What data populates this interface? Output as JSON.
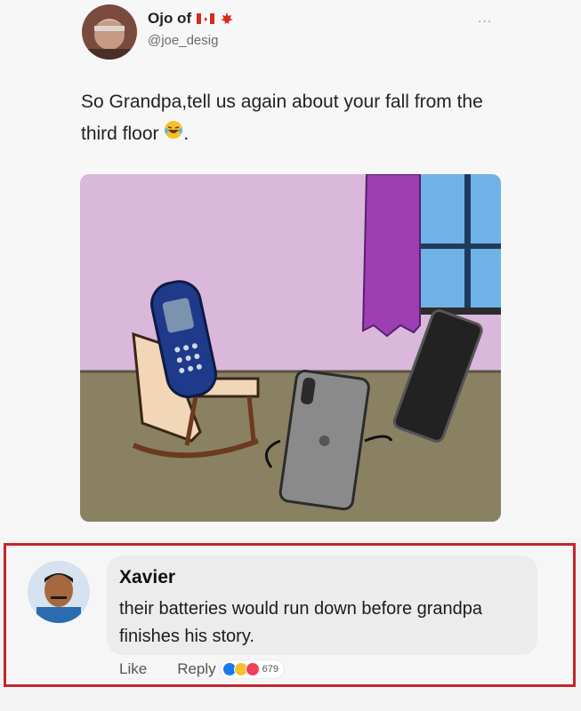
{
  "tweet": {
    "author_name": "Ojo of",
    "handle": "@joe_desig",
    "more_label": "...",
    "text": "So Grandpa,tell us again about your fall from the third floor",
    "text_end": ".",
    "flag_icon": "canada-flag-icon",
    "emoji_icon": "laughing-tears-emoji-icon"
  },
  "comment": {
    "author_name": "Xavier",
    "text": "their batteries would run down before grandpa finishes his story.",
    "like_label": "Like",
    "reply_label": "Reply",
    "reaction_count": "679",
    "reaction_icons": [
      "like-icon",
      "haha-icon",
      "love-icon"
    ],
    "highlight_color": "#c1272d"
  }
}
